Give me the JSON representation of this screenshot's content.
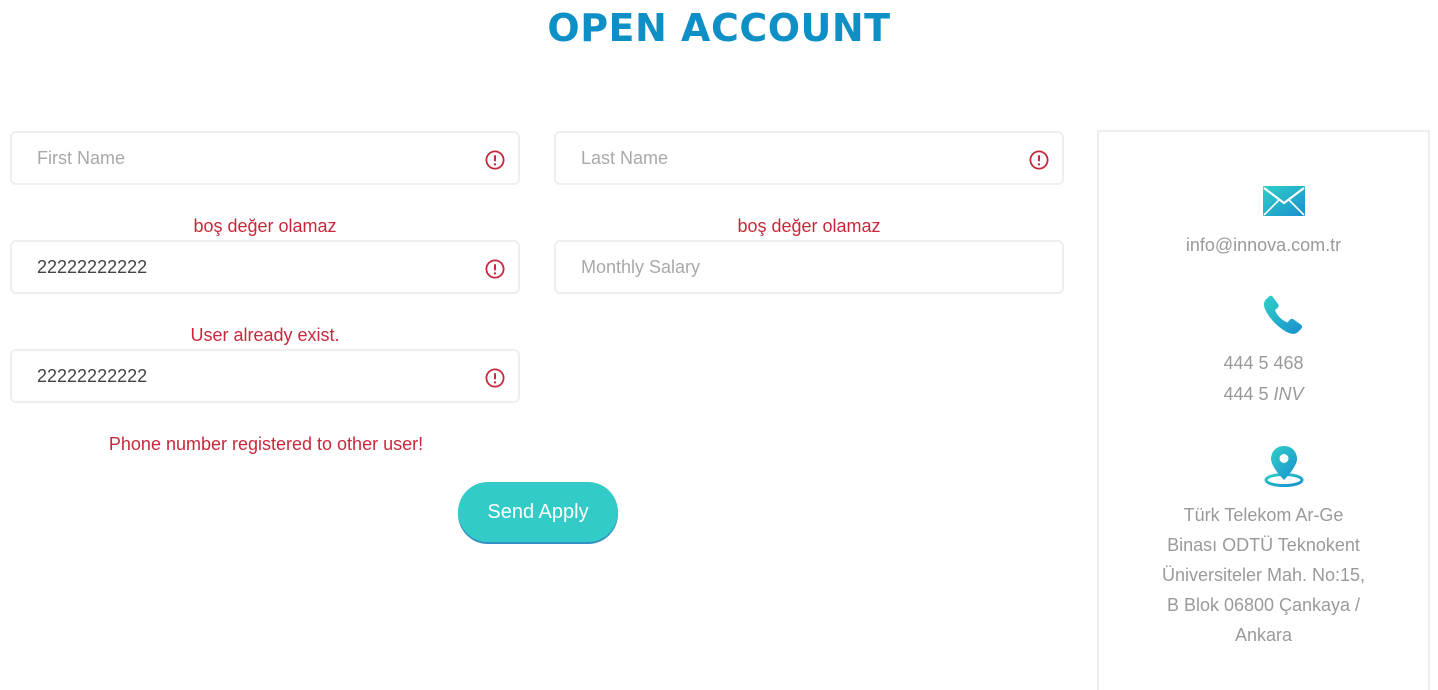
{
  "page": {
    "title": "OPEN ACCOUNT"
  },
  "form": {
    "first_name": {
      "placeholder": "First Name",
      "value": "",
      "error": "boş değer olamaz"
    },
    "last_name": {
      "placeholder": "Last Name",
      "value": "",
      "error": "boş değer olamaz"
    },
    "id_number": {
      "placeholder": "",
      "value": "22222222222",
      "error": "User already exist."
    },
    "monthly_salary": {
      "placeholder": "Monthly Salary",
      "value": ""
    },
    "phone": {
      "placeholder": "",
      "value": "22222222222",
      "error": "Phone number registered to other user!"
    },
    "submit_label": "Send Apply"
  },
  "contact": {
    "email": "info@innova.com.tr",
    "phone_line1": "444 5 468",
    "phone_line2_prefix": "444 5 ",
    "phone_line2_suffix": "INV",
    "address_lines": [
      "Türk Telekom Ar-Ge",
      "Binası ODTÜ Teknokent",
      "Üniversiteler Mah. No:15,",
      "B Blok 06800 Çankaya /",
      "Ankara"
    ],
    "icons": {
      "email": "envelope-icon",
      "phone": "phone-icon",
      "address": "location-pin-icon"
    }
  },
  "colors": {
    "title": "#0e8fc6",
    "error": "#c8283c",
    "button": "#32cbc7",
    "icon_gradient_start": "#2fd0c6",
    "icon_gradient_end": "#1a8fd0"
  }
}
